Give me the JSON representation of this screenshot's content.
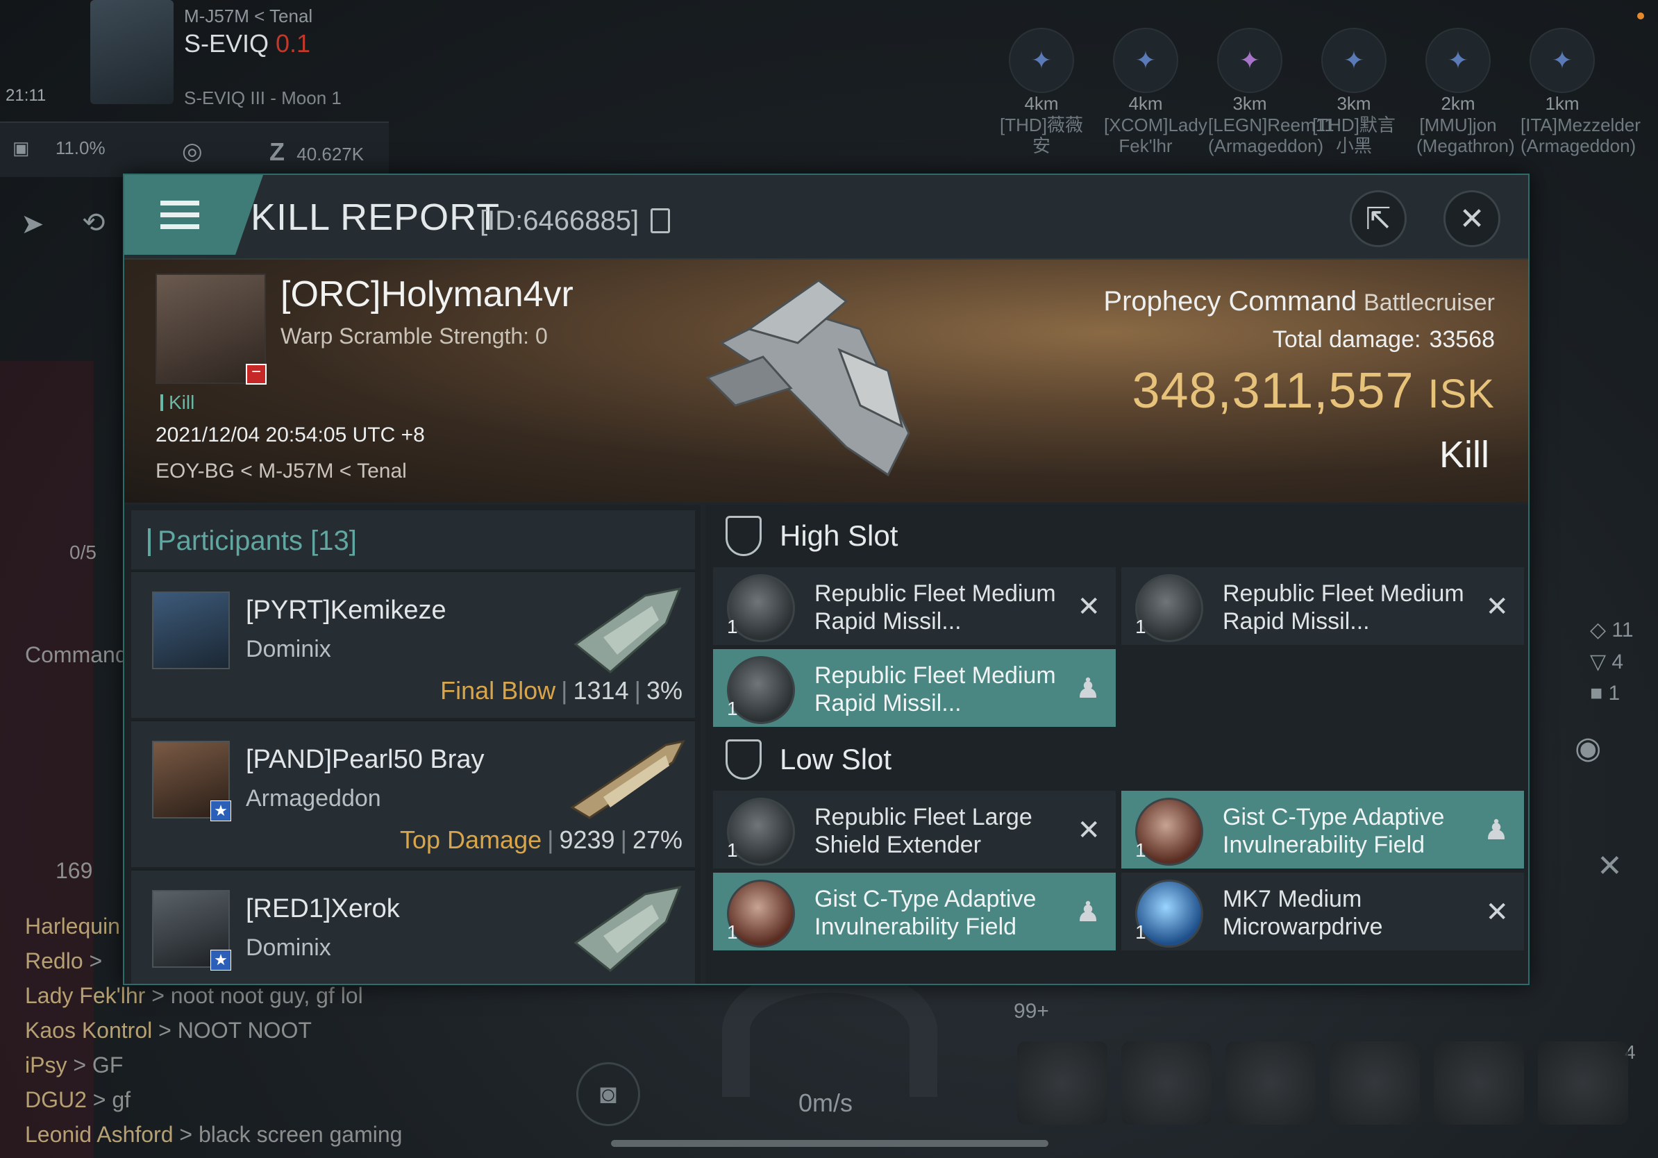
{
  "hud": {
    "system_path": "M-J57M < Tenal",
    "system_name": "S-EVIQ",
    "security": "0.1",
    "moon": "S-EVIQ III - Moon 1",
    "time": "21:11",
    "stat_cargo": "11.0%",
    "stat_isk": "40.627K",
    "speed": "0m/s",
    "counters": [
      "11",
      "4",
      "1"
    ],
    "module_badge": "99+",
    "module_count": "4"
  },
  "overview": [
    {
      "dist": "4km",
      "name": "[THD]薇薇安"
    },
    {
      "dist": "4km",
      "name": "[XCOM]Lady Fek'lhr"
    },
    {
      "dist": "3km",
      "name": "[LEGN]Reem11 (Armageddon)"
    },
    {
      "dist": "3km",
      "name": "[THD]默言小黑"
    },
    {
      "dist": "2km",
      "name": "[MMU]jon (Megathron)"
    },
    {
      "dist": "1km",
      "name": "[ITA]Mezzelder (Armageddon)"
    }
  ],
  "chat": [
    {
      "name": "Harlequin",
      "msg": ""
    },
    {
      "name": "Redlo",
      "msg": ">"
    },
    {
      "name": "Lady Fek'lhr",
      "msg": "> noot noot guy, gf lol"
    },
    {
      "name": "Kaos Kontrol",
      "msg": "> NOOT NOOT"
    },
    {
      "name": "iPsy",
      "msg": "> GF"
    },
    {
      "name": "DGU2",
      "msg": "> gf"
    },
    {
      "name": "Leonid Ashford",
      "msg": "> black screen gaming"
    }
  ],
  "chat_side": {
    "label": "Command",
    "count": "169",
    "fraction": "0/5"
  },
  "kill_report": {
    "title": "KILL REPORT",
    "id": "[ID:6466885]",
    "victim": {
      "name": "[ORC]Holyman4vr",
      "warp": "Warp Scramble Strength: 0",
      "tag": "Kill",
      "date": "2021/12/04 20:54:05 UTC +8",
      "location": "EOY-BG < M-J57M < Tenal"
    },
    "ship": {
      "name": "Prophecy Command",
      "class": "Battlecruiser",
      "damage_label": "Total damage:",
      "damage": "33568",
      "isk": "348,311,557",
      "currency": "ISK",
      "result": "Kill"
    },
    "participants_title": "Participants [13]",
    "participants": [
      {
        "name": "[PYRT]Kemikeze",
        "ship": "Dominix",
        "label": "Final Blow",
        "damage": "1314",
        "pct": "3%"
      },
      {
        "name": "[PAND]Pearl50 Bray",
        "ship": "Armageddon",
        "label": "Top Damage",
        "damage": "9239",
        "pct": "27%"
      },
      {
        "name": "[RED1]Xerok",
        "ship": "Dominix",
        "label": "",
        "damage": "",
        "pct": ""
      }
    ],
    "high_slot_title": "High Slot",
    "high_slot": [
      {
        "name": "Republic Fleet Medium Rapid Missil...",
        "qty": "1",
        "status": "destroyed"
      },
      {
        "name": "Republic Fleet Medium Rapid Missil...",
        "qty": "1",
        "status": "destroyed"
      },
      {
        "name": "Republic Fleet Medium Rapid Missil...",
        "qty": "1",
        "status": "dropped"
      }
    ],
    "low_slot_title": "Low Slot",
    "low_slot": [
      {
        "name": "Republic Fleet Large Shield Extender",
        "qty": "1",
        "status": "destroyed"
      },
      {
        "name": "Gist C-Type Adaptive Invulnerability Field",
        "qty": "1",
        "status": "dropped"
      },
      {
        "name": "Gist C-Type Adaptive Invulnerability Field",
        "qty": "1",
        "status": "dropped"
      },
      {
        "name": "MK7 Medium Microwarpdrive",
        "qty": "1",
        "status": "destroyed"
      }
    ]
  },
  "icons": {
    "close": "close-icon",
    "share": "share-icon",
    "menu": "menu-icon",
    "destroyed": "x-mark-icon",
    "dropped": "person-icon"
  },
  "colors": {
    "accent": "#4b8782",
    "isk": "#e7c27a",
    "final_blow": "#d9a54a",
    "security": "#c0392b"
  }
}
